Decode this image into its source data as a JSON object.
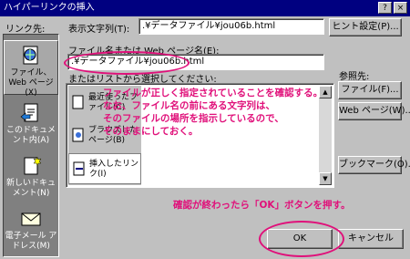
{
  "dialog": {
    "title": "ハイパーリンクの挿入",
    "close_label": "×",
    "help_label": "?"
  },
  "linkbar": {
    "heading": "リンク先:",
    "items": [
      {
        "label": "ファイル、Web ページ(X)",
        "icon": "globe-document-icon",
        "active": true
      },
      {
        "label": "このドキュメント内(A)",
        "icon": "document-arrow-icon",
        "active": false
      },
      {
        "label": "新しいドキュメント(N)",
        "icon": "new-document-icon",
        "active": false
      },
      {
        "label": "電子メール アドレス(M)",
        "icon": "envelope-icon",
        "active": false
      }
    ]
  },
  "display_text": {
    "label": "表示文字列(T):",
    "value": ".¥データファイル¥jou06b.html",
    "screentip_button": "ヒント設定(P)..."
  },
  "address": {
    "label": "ファイル名または Web ページ名(E):",
    "value": ".¥データファイル¥jou06b.html",
    "list_label": "またはリストから選択してください:"
  },
  "list": {
    "options": [
      {
        "label": "最近使ったファイル(C)"
      },
      {
        "label": "ブラウズしたページ(B)"
      },
      {
        "label": "挿入したリンク(I)"
      }
    ]
  },
  "browse": {
    "heading": "参照先:",
    "file_button": "ファイル(F)...",
    "web_button": "Web ページ(W)...",
    "bookmark_button": "ブックマーク(O)..."
  },
  "footer": {
    "ok_button": "OK",
    "cancel_button": "キャンセル"
  },
  "annotations": {
    "note_1": "ファイルが正しく指定されていることを確認する。",
    "note_2": "なお、ファイル名の前にある文字列は、",
    "note_3": "そのファイルの場所を指示しているので、",
    "note_4": "そのままにしておく。",
    "note_ok": "確認が終わったら「OK」ボタンを押す。",
    "color": "#e0107a"
  }
}
